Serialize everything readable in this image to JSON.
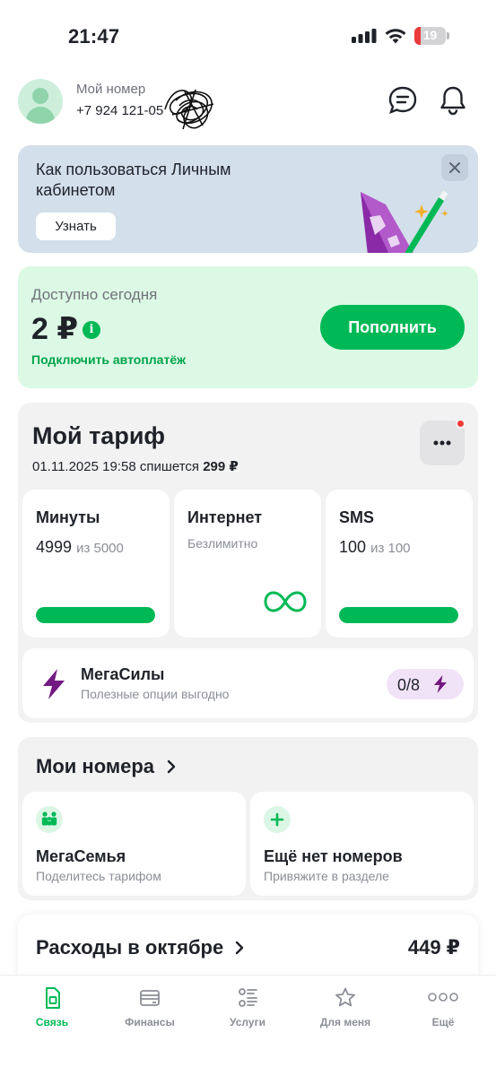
{
  "status_bar": {
    "time": "21:47",
    "battery_level": "19",
    "battery_fraction": 0.19,
    "battery_color": "#ea3a3a"
  },
  "profile": {
    "label": "Мой номер",
    "number": "+7 924 121-05"
  },
  "promo": {
    "title": "Как пользоваться Личным кабинетом",
    "button_label": "Узнать",
    "background": "#d3dfeb"
  },
  "balance": {
    "label": "Доступно сегодня",
    "amount": "2 ₽",
    "info_icon": "i",
    "autopay_link": "Подключить автоплатёж",
    "topup_label": "Пополнить",
    "background": "#dcf9e5"
  },
  "tariff": {
    "title": "Мой тариф",
    "charge_date": "01.11.2025 19:58 спишется",
    "charge_amount": "299 ₽",
    "minutes": {
      "title": "Минуты",
      "remaining": "4999",
      "of_label": "из 5000",
      "fraction": 0.9998
    },
    "internet": {
      "title": "Интернет",
      "subtitle": "Безлимитно"
    },
    "sms": {
      "title": "SMS",
      "remaining": "100",
      "of_label": "из 100",
      "fraction": 1.0
    },
    "megasily": {
      "title": "МегаСилы",
      "subtitle": "Полезные опции выгодно",
      "count": "0/8"
    }
  },
  "my_numbers": {
    "title": "Мои номера",
    "family": {
      "title": "МегаСемья",
      "subtitle": "Поделитесь тарифом"
    },
    "add": {
      "title": "Ещё нет номеров",
      "subtitle": "Привяжите в разделе"
    }
  },
  "expenses": {
    "title": "Расходы в октябре",
    "total": "449 ₽"
  },
  "tabbar": {
    "items": [
      {
        "label": "Связь",
        "icon": "sim-icon",
        "active": true
      },
      {
        "label": "Финансы",
        "icon": "wallet-icon",
        "active": false
      },
      {
        "label": "Услуги",
        "icon": "services-icon",
        "active": false
      },
      {
        "label": "Для меня",
        "icon": "star-icon",
        "active": false
      },
      {
        "label": "Ещё",
        "icon": "more-icon",
        "active": false
      }
    ]
  },
  "colors": {
    "brand_green": "#00b956",
    "accent_purple": "#731982",
    "alert_red": "#ee3b36"
  }
}
